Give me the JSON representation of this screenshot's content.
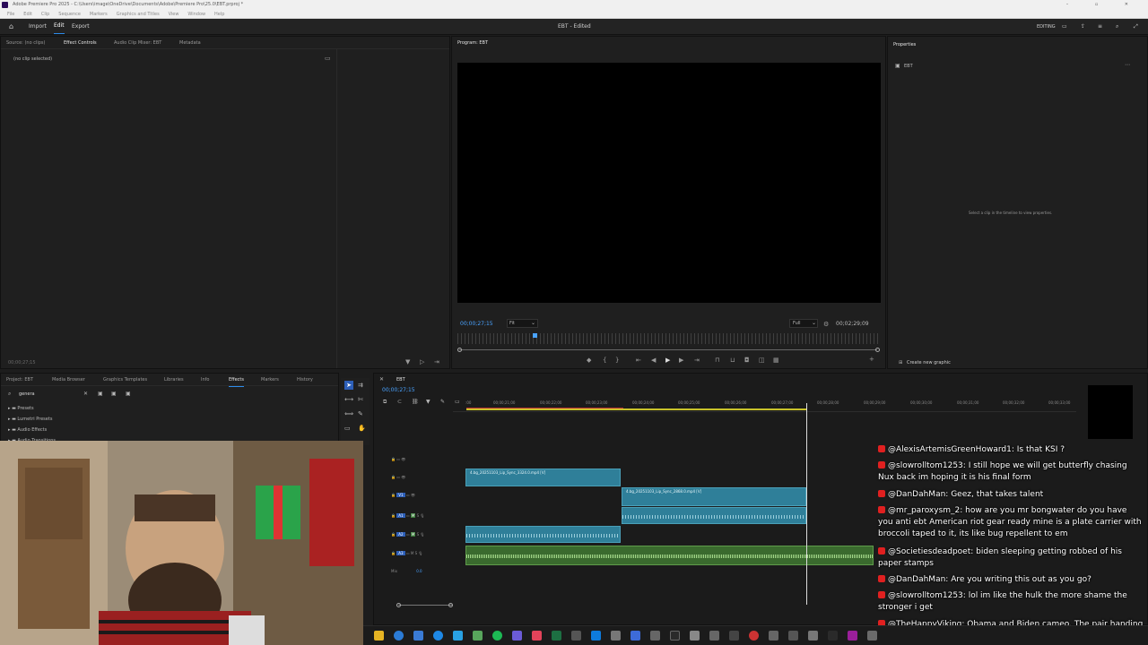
{
  "window": {
    "title": "Adobe Premiere Pro 2025 - C:\\Users\\image\\OneDrive\\Documents\\Adobe\\Premiere Pro\\25.0\\EBT.prproj *"
  },
  "menu": [
    "File",
    "Edit",
    "Clip",
    "Sequence",
    "Markers",
    "Graphics and Titles",
    "View",
    "Window",
    "Help"
  ],
  "workspace": {
    "tabs": {
      "import": "Import",
      "edit": "Edit",
      "export": "Export"
    },
    "project_title": "EBT - Edited",
    "mode": "EDITING"
  },
  "source_panel": {
    "tabs": [
      "Source: (no clips)",
      "Effect Controls",
      "Audio Clip Mixer: EBT",
      "Metadata"
    ],
    "no_clip": "(no clip selected)",
    "timecode": "00;00;27;15"
  },
  "program_monitor": {
    "tab": "Program: EBT",
    "timecode": "00;00;27;15",
    "fit": "Fit",
    "resolution": "Full",
    "duration": "00;02;29;09"
  },
  "properties": {
    "tab": "Properties",
    "item": "EBT",
    "hint": "Select a clip in the timeline to view properties.",
    "create_graphic": "Create new graphic"
  },
  "project_panel": {
    "tabs": [
      "Project: EBT",
      "Media Browser",
      "Graphics Templates",
      "Libraries",
      "Info",
      "Effects",
      "Markers",
      "History"
    ],
    "active_tab": "Effects",
    "search_value": "genera",
    "tree": [
      "Presets",
      "Lumetri Presets",
      "Audio Effects",
      "Audio Transitions"
    ]
  },
  "timeline": {
    "tab": "EBT",
    "timecode": "00;00;27;15",
    "ruler_ticks": [
      ":00",
      "00;00;21;00",
      "00;00;22;00",
      "00;00;23;00",
      "00;00;24;00",
      "00;00;25;00",
      "00;00;26;00",
      "00;00;27;00",
      "00;00;28;00",
      "00;00;29;00",
      "00;00;30;00",
      "00;00;31;00",
      "00;00;32;00",
      "00;00;33;00"
    ],
    "video_tracks": [
      "V3",
      "V2",
      "V1"
    ],
    "audio_tracks": [
      "A1",
      "A2",
      "A3"
    ],
    "mix_label": "Mix",
    "mix_value": "0.0",
    "clips": {
      "v1_first": "4.bg_20251103_Lip_Sync_3324.0.mp4 [V]",
      "v1_second": "4.bg_20251103_Lip_Sync_2868.0.mp4 [V]"
    }
  },
  "chat": [
    {
      "user": "@AlexisArtemisGreenHoward1:",
      "text": "Is that KSI ?"
    },
    {
      "user": "@slowrolltom1253:",
      "text": "I still hope we will get butterfly chasing Nux back im hoping it is his final form"
    },
    {
      "user": "@DanDahMan:",
      "text": "Geez, that takes talent"
    },
    {
      "user": "@mr_paroxysm_2:",
      "text": "how are you mr bongwater do you have you anti ebt American riot gear ready mine is a plate carrier with broccoli taped to it, its like bug repellent to em"
    },
    {
      "user": "@Societiesdeadpoet:",
      "text": "biden sleeping getting robbed of his paper stamps"
    },
    {
      "user": "@DanDahMan:",
      "text": "Are you writing this out as you go?"
    },
    {
      "user": "@slowrolltom1253:",
      "text": "lol im like the hulk the more shame the stronger i get"
    },
    {
      "user": "@TheHappyViking:",
      "text": "Obama and Biden cameo. The pair handing out literal food stamps. ???"
    }
  ],
  "colors": {
    "accent": "#2d8ceb",
    "video_clip": "#2f7f99",
    "audio_clip": "#3a6a2e",
    "chat_badge": "#e02020"
  }
}
